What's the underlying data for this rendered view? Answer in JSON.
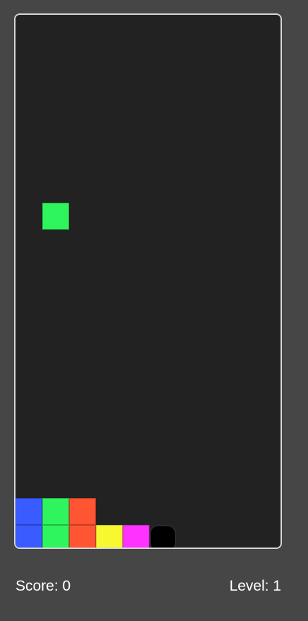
{
  "game": {
    "board": {
      "cols": 10,
      "rows": 20,
      "colors": {
        "empty": "#222222",
        "border": "#d6d6d6",
        "background": "#464646"
      },
      "falling_piece": [
        {
          "col": 1,
          "row": 7,
          "color": "#2ef55d"
        }
      ],
      "locked_cells": [
        {
          "col": 0,
          "row": 18,
          "color": "#3a5bff"
        },
        {
          "col": 1,
          "row": 18,
          "color": "#2ef55d"
        },
        {
          "col": 2,
          "row": 18,
          "color": "#ff5533"
        },
        {
          "col": 0,
          "row": 19,
          "color": "#3a5bff"
        },
        {
          "col": 1,
          "row": 19,
          "color": "#2ef55d"
        },
        {
          "col": 2,
          "row": 19,
          "color": "#ff5533"
        },
        {
          "col": 3,
          "row": 19,
          "color": "#f8f830"
        },
        {
          "col": 4,
          "row": 19,
          "color": "#ff33ff"
        },
        {
          "col": 5,
          "row": 19,
          "color": "#000000",
          "kind": "bomb"
        }
      ]
    },
    "score_text": "Score: 0",
    "level_text": "Level: 1"
  }
}
